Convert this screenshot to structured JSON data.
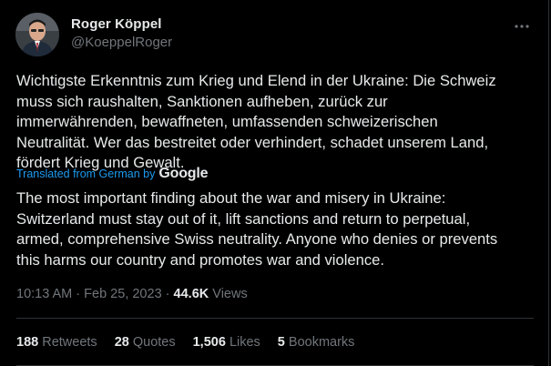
{
  "author": {
    "name": "Roger Köppel",
    "handle": "@KoeppelRoger"
  },
  "tweet": {
    "original_text": "Wichtigste Erkenntnis zum Krieg und Elend in der Ukraine: Die Schweiz\nmuss sich raushalten, Sanktionen aufheben, zurück zur\nimmerwährenden, bewaffneten, umfassenden schweizerischen\nNeutralität. Wer das bestreitet oder verhindert, schadet unserem Land,\nfördert Krieg und Gewalt.",
    "translated_label": "Translated from German by",
    "translator": "Google",
    "translated_text": "The most important finding about the war and misery in Ukraine:\nSwitzerland must stay out of it, lift sanctions and return to perpetual,\narmed, comprehensive Swiss neutrality. Anyone who denies or prevents\nthis harms our country and promotes war and violence.",
    "time": "10:13 AM",
    "separator": "·",
    "date": "Feb 25, 2023",
    "views_count": "44.6K",
    "views_label": "Views"
  },
  "stats": {
    "retweets_count": "188",
    "retweets_label": "Retweets",
    "quotes_count": "28",
    "quotes_label": "Quotes",
    "likes_count": "1,506",
    "likes_label": "Likes",
    "bookmarks_count": "5",
    "bookmarks_label": "Bookmarks"
  },
  "icons": {
    "more": "more-horizontal-icon",
    "avatar": "profile-photo"
  },
  "colors": {
    "background": "#000000",
    "text": "#e7e9ea",
    "muted": "#71767b",
    "link": "#1d9bf0",
    "divider": "#2f3336"
  }
}
